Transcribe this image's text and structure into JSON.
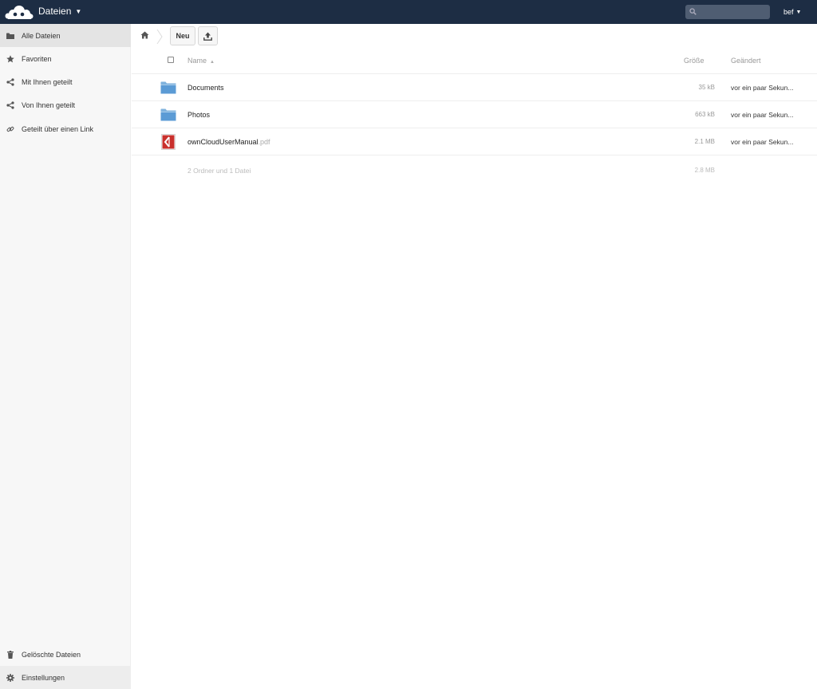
{
  "header": {
    "app_name": "Dateien",
    "search": {
      "placeholder": "",
      "value": ""
    },
    "user": "bef"
  },
  "sidebar": {
    "items": [
      {
        "label": "Alle Dateien",
        "icon": "folder-icon",
        "active": true
      },
      {
        "label": "Favoriten",
        "icon": "star-icon"
      },
      {
        "label": "Mit Ihnen geteilt",
        "icon": "share-icon"
      },
      {
        "label": "Von Ihnen geteilt",
        "icon": "share-icon"
      },
      {
        "label": "Geteilt über einen Link",
        "icon": "link-icon"
      }
    ],
    "deleted_label": "Gelöschte Dateien",
    "settings_label": "Einstellungen"
  },
  "controls": {
    "new_label": "Neu"
  },
  "table": {
    "headers": {
      "name": "Name",
      "size": "Größe",
      "modified": "Geändert"
    },
    "rows": [
      {
        "name": "Documents",
        "ext": "",
        "type": "folder",
        "size": "35 kB",
        "modified": "vor ein paar Sekun..."
      },
      {
        "name": "Photos",
        "ext": "",
        "type": "folder",
        "size": "663 kB",
        "modified": "vor ein paar Sekun..."
      },
      {
        "name": "ownCloudUserManual",
        "ext": ".pdf",
        "type": "pdf",
        "size": "2.1 MB",
        "modified": "vor ein paar Sekun..."
      }
    ],
    "summary": {
      "text": "2 Ordner und 1 Datei",
      "size": "2.8 MB"
    }
  },
  "colors": {
    "header_bg": "#1d2d44",
    "sidebar_bg": "#f7f7f7",
    "active_item_bg": "#e4e4e4",
    "folder_blue": "#5b9bd5",
    "pdf_red": "#c9302c"
  }
}
